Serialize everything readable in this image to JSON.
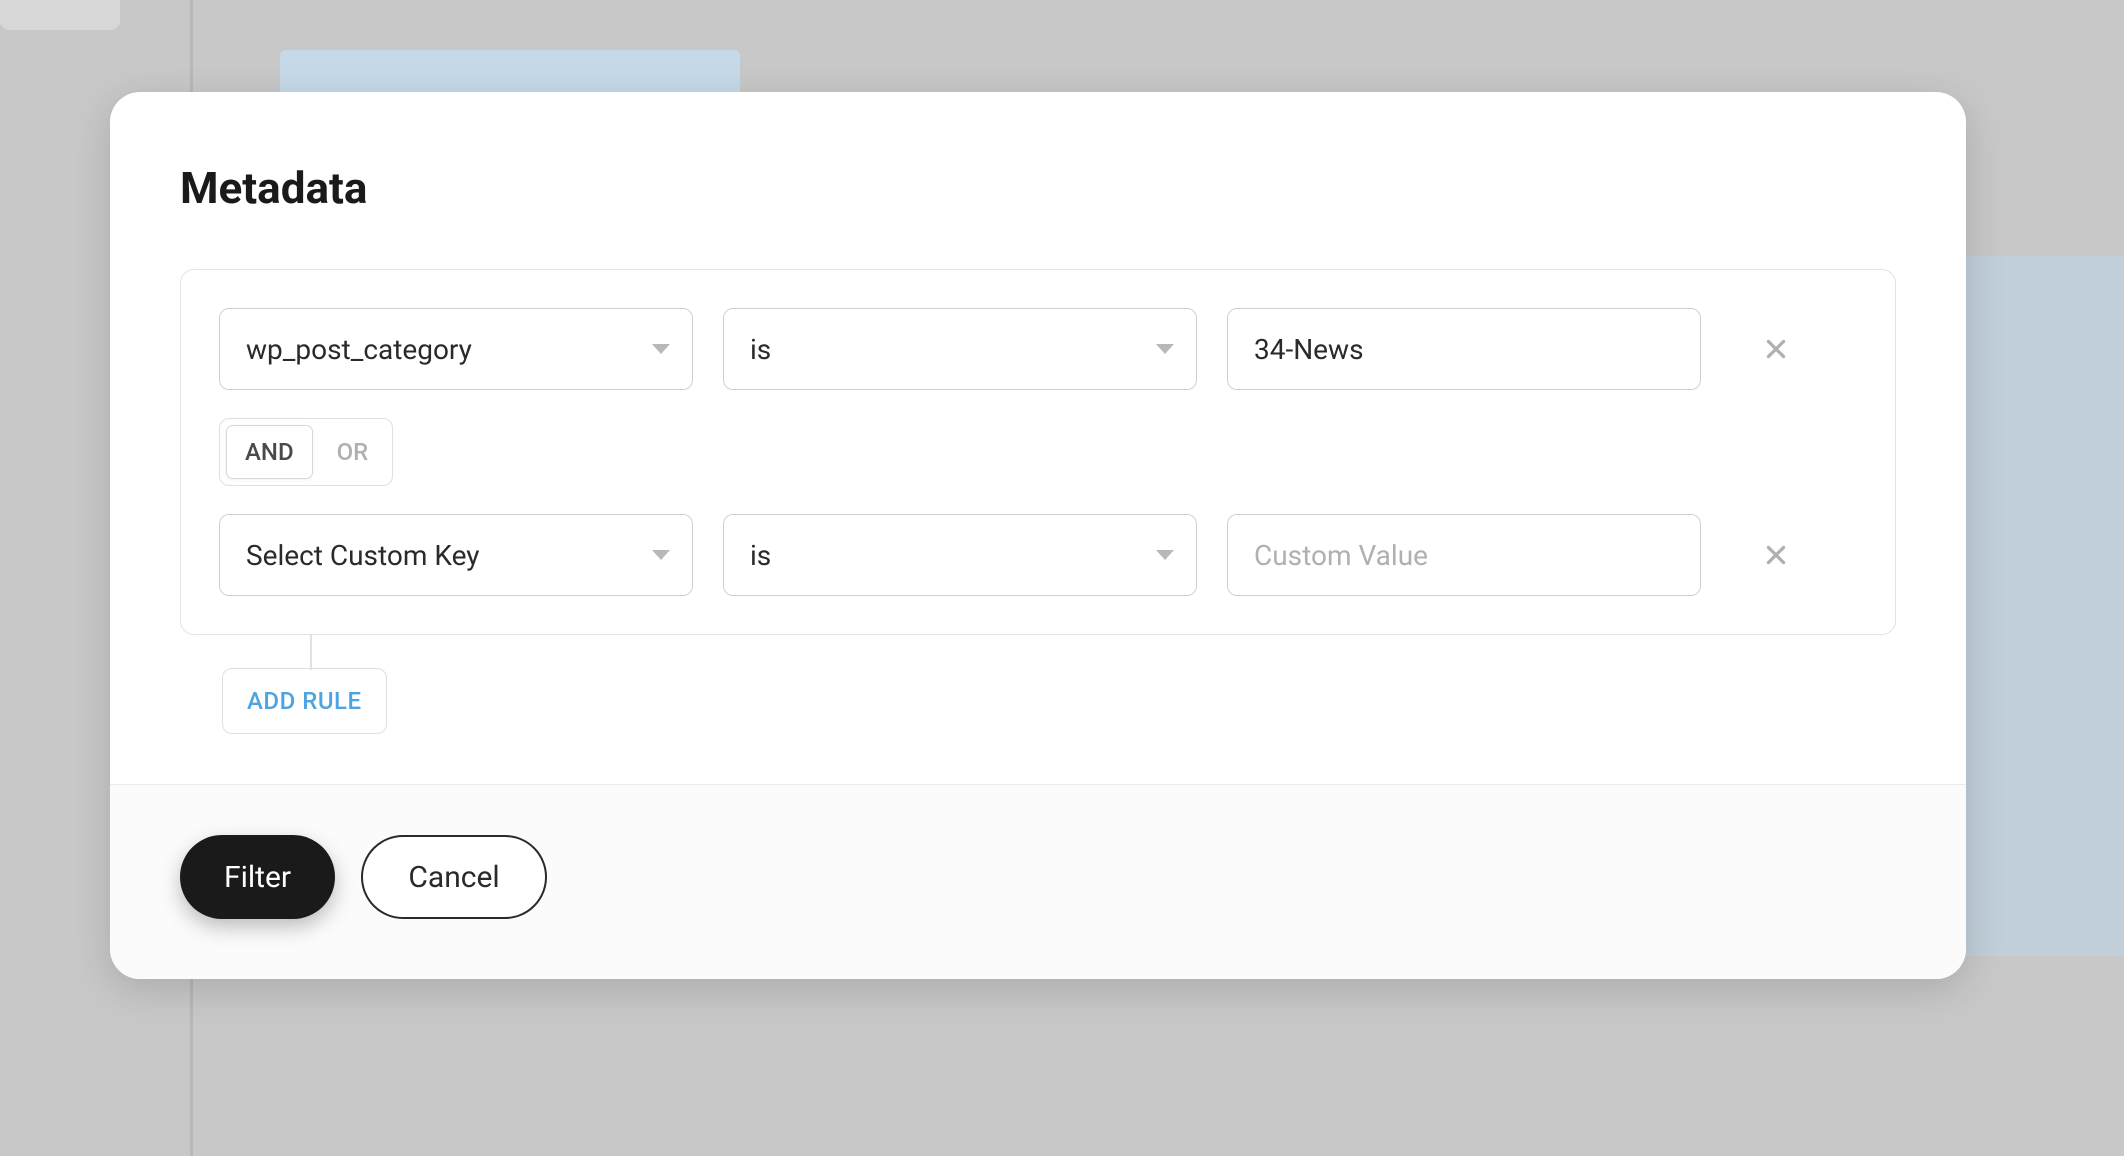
{
  "modal": {
    "title": "Metadata",
    "rules": [
      {
        "key": "wp_post_category",
        "operator": "is",
        "value": "34-News",
        "value_placeholder": "Custom Value",
        "connector_after": "AND"
      },
      {
        "key": "Select Custom Key",
        "operator": "is",
        "value": "",
        "value_placeholder": "Custom Value"
      }
    ],
    "connector_options": {
      "and": "AND",
      "or": "OR"
    },
    "add_rule_label": "ADD RULE",
    "footer": {
      "filter_label": "Filter",
      "cancel_label": "Cancel"
    }
  }
}
